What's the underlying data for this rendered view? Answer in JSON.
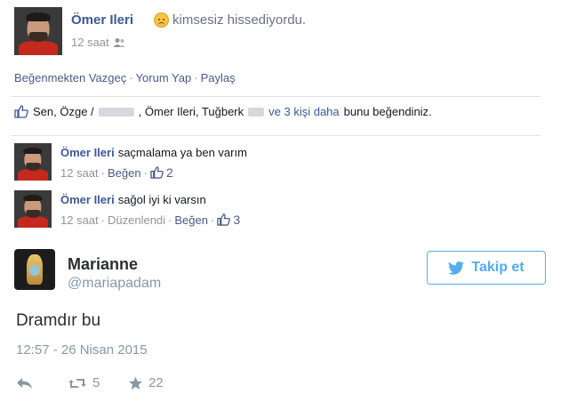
{
  "facebook": {
    "post": {
      "author": "Ömer Ileri",
      "status": "kimsesiz hissediyordu.",
      "emoji": "sad-face",
      "time": "12 saat"
    },
    "actions": [
      "Beğenmekten Vazgeç",
      "Yorum Yap",
      "Paylaş"
    ],
    "actions_separator": "·",
    "likes": {
      "part1": "Sen, Özge /",
      "part2": ", Ömer Ileri, Tuğberk",
      "part3": "ve 3 kişi daha",
      "part4": "bunu beğendiniz."
    },
    "comments": [
      {
        "author": "Ömer Ileri",
        "text": "saçmalama ya ben varım",
        "time": "12 saat",
        "edited": "",
        "like_label": "Beğen",
        "like_count": "2"
      },
      {
        "author": "Ömer Ileri",
        "text": "sağol iyi ki varsın",
        "time": "12 saat",
        "edited": "Düzenlendi",
        "like_label": "Beğen",
        "like_count": "3"
      }
    ],
    "colors": {
      "link": "#3b5998",
      "meta": "#90949c"
    }
  },
  "twitter": {
    "name": "Marianne",
    "handle": "@mariapadam",
    "follow_label": "Takip et",
    "tweet": "Dramdır bu",
    "date": "12:57 - 26 Nisan 2015",
    "retweets": "5",
    "favorites": "22",
    "colors": {
      "accent": "#55acee",
      "muted": "#8899a6"
    }
  }
}
